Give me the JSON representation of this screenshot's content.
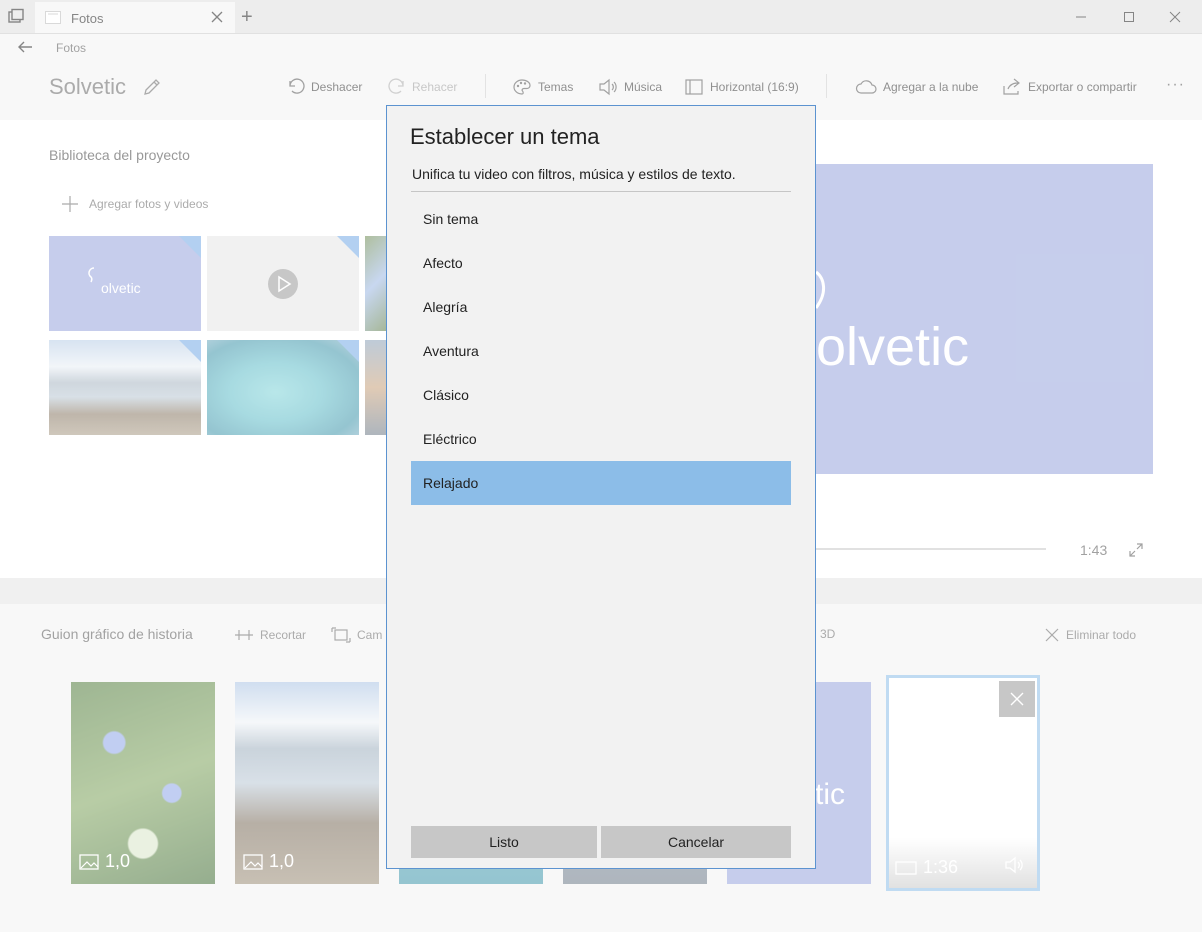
{
  "window": {
    "tab_title": "Fotos",
    "new_tab_symbol": "+",
    "controls": [
      "minimize",
      "maximize",
      "close"
    ]
  },
  "header": {
    "breadcrumb": "Fotos",
    "project_title": "Solvetic",
    "toolbar": {
      "undo": "Deshacer",
      "redo": "Rehacer",
      "themes": "Temas",
      "music": "Música",
      "aspect": "Horizontal (16:9)",
      "cloud": "Agregar a la nube",
      "export": "Exportar o compartir",
      "more": "···"
    }
  },
  "library": {
    "title": "Biblioteca del proyecto",
    "add_label": "Agregar fotos y videos",
    "logo_text": "olvetic"
  },
  "preview": {
    "logo_text": "olvetic",
    "time": "1:43"
  },
  "storyboard": {
    "title": "Guion gráfico de historia",
    "trim": "Recortar",
    "resize": "Cam",
    "effects_3d": "3D",
    "delete_all": "Eliminar todo",
    "cards": [
      {
        "duration": "1,0"
      },
      {
        "duration": "1,0"
      },
      {
        "duration": ""
      },
      {
        "duration": ""
      },
      {
        "duration": "",
        "logo_text": "tic"
      },
      {
        "duration": "1:36"
      }
    ]
  },
  "dialog": {
    "title": "Establecer un tema",
    "subtitle": "Unifica tu video con filtros, música y estilos de texto.",
    "themes": [
      "Sin tema",
      "Afecto",
      "Alegría",
      "Aventura",
      "Clásico",
      "Eléctrico",
      "Relajado"
    ],
    "selected_index": 6,
    "done": "Listo",
    "cancel": "Cancelar"
  },
  "colors": {
    "accent": "#8cbde8",
    "dialog_border": "#5c93d0",
    "preview_bg": "#98a5dd"
  }
}
